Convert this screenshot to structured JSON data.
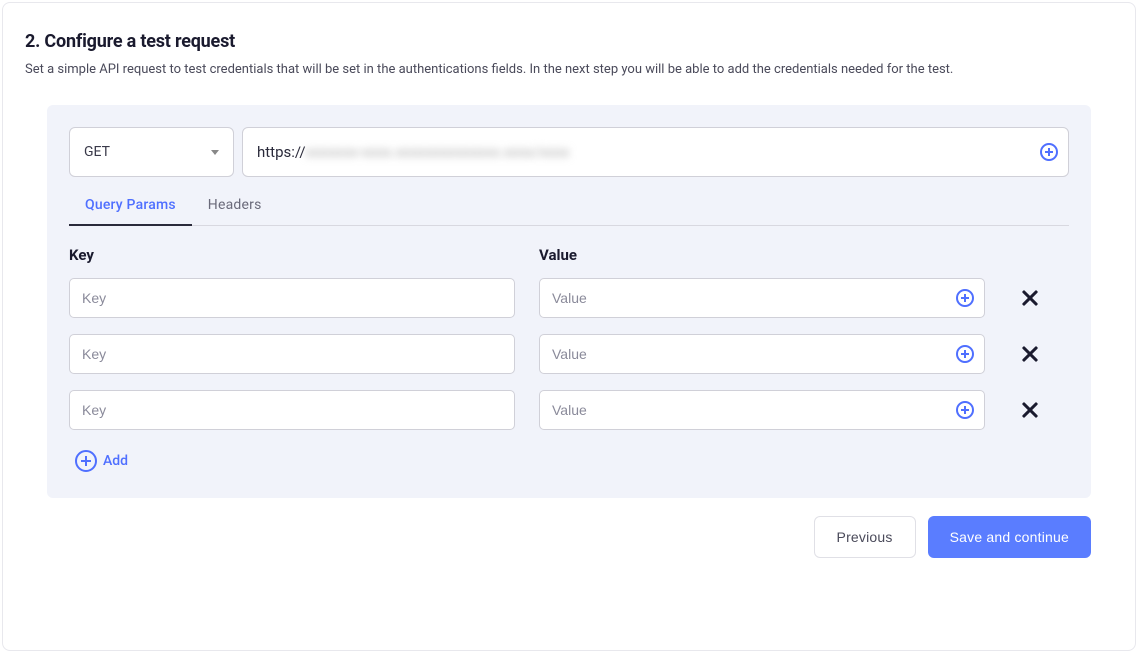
{
  "section": {
    "title": "2. Configure a test request",
    "description": "Set a simple API request to test credentials that will be set in the authentications fields. In the next step you will be able to add the credentials needed for the test."
  },
  "request": {
    "method": "GET",
    "url_prefix": "https://",
    "url_obscured": "xxxxxxx-xxxx.xxxxxxxxxxxxxx.xxxx/xxxx"
  },
  "tabs": {
    "query_params": "Query Params",
    "headers": "Headers",
    "active": "query_params"
  },
  "columns": {
    "key": "Key",
    "value": "Value"
  },
  "rows": [
    {
      "key": "",
      "value": "",
      "key_placeholder": "Key",
      "value_placeholder": "Value"
    },
    {
      "key": "",
      "value": "",
      "key_placeholder": "Key",
      "value_placeholder": "Value"
    },
    {
      "key": "",
      "value": "",
      "key_placeholder": "Key",
      "value_placeholder": "Value"
    }
  ],
  "buttons": {
    "add": "Add",
    "previous": "Previous",
    "save_continue": "Save and continue"
  }
}
